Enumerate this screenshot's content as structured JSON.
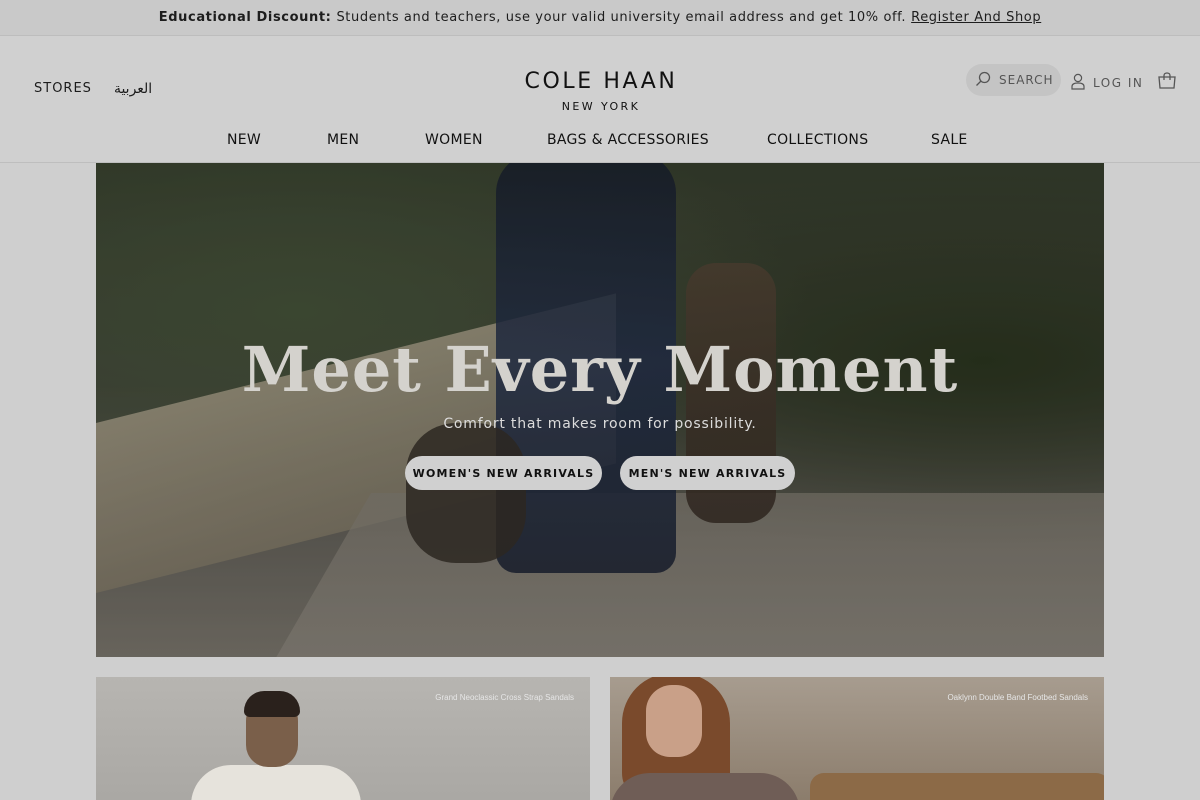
{
  "promo": {
    "label": "Educational Discount:",
    "text": "Students and teachers, use your valid university email address and get 10% off.",
    "link": "Register And Shop"
  },
  "header": {
    "stores": "STORES",
    "language": "العربية",
    "brand": "COLE HAAN",
    "brand_sub": "NEW YORK",
    "search_label": "SEARCH",
    "login_label": "LOG IN",
    "icons": {
      "search": "search-icon",
      "user": "user-icon",
      "bag": "shopping-bag-icon"
    }
  },
  "nav": [
    "NEW",
    "MEN",
    "WOMEN",
    "BAGS & ACCESSORIES",
    "COLLECTIONS",
    "SALE"
  ],
  "hero": {
    "title": "Meet Every Moment",
    "subtitle": "Comfort that makes room for possibility.",
    "buttons": [
      "WOMEN'S NEW ARRIVALS",
      "MEN'S NEW ARRIVALS"
    ]
  },
  "tiles": [
    {
      "caption": "Grand Neoclassic Cross Strap Sandals"
    },
    {
      "caption": "Oaklynn Double Band Footbed Sandals"
    }
  ],
  "colors": {
    "page_bg": "#cfcfcf",
    "button_bg": "#d0d0d0",
    "title": "#d4d2cd"
  }
}
